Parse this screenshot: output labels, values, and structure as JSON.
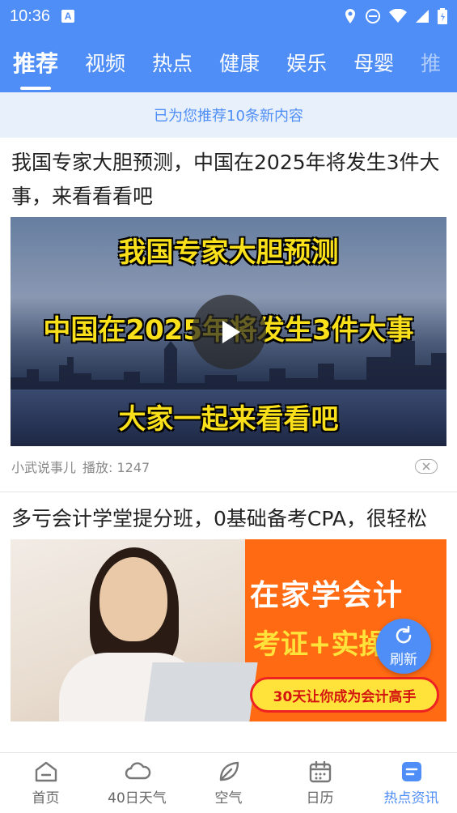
{
  "status_bar": {
    "time": "10:36",
    "notification_letter": "A"
  },
  "tabs": [
    {
      "label": "推荐",
      "active": true
    },
    {
      "label": "视频",
      "active": false
    },
    {
      "label": "热点",
      "active": false
    },
    {
      "label": "健康",
      "active": false
    },
    {
      "label": "娱乐",
      "active": false
    },
    {
      "label": "母婴",
      "active": false
    },
    {
      "label": "推",
      "active": false
    }
  ],
  "notice": {
    "text": "已为您推荐10条新内容"
  },
  "articles": [
    {
      "title": "我国专家大胆预测，中国在2025年将发生3件大事，来看看看吧",
      "overlay_lines": [
        "我国专家大胆预测",
        "中国在2025年将发生3件大事",
        "大家一起来看看吧"
      ],
      "author": "小武说事儿",
      "plays": "播放: 1247"
    },
    {
      "title": "多亏会计学堂提分班，0基础备考CPA，很轻松",
      "ad_headline": "在家学会计",
      "ad_subline": "考证+实操",
      "ad_pill": "30天让你成为会计高手"
    }
  ],
  "refresh": {
    "label": "刷新"
  },
  "bottom_nav": [
    {
      "label": "首页",
      "icon": "home-icon",
      "active": false
    },
    {
      "label": "40日天气",
      "icon": "cloud-icon",
      "active": false
    },
    {
      "label": "空气",
      "icon": "leaf-icon",
      "active": false
    },
    {
      "label": "日历",
      "icon": "calendar-icon",
      "active": false
    },
    {
      "label": "热点资讯",
      "icon": "news-icon",
      "active": true
    }
  ],
  "colors": {
    "brand_blue": "#4f8ef7",
    "overlay_yellow": "#f9e01a",
    "ad_orange": "#ff6a13"
  }
}
